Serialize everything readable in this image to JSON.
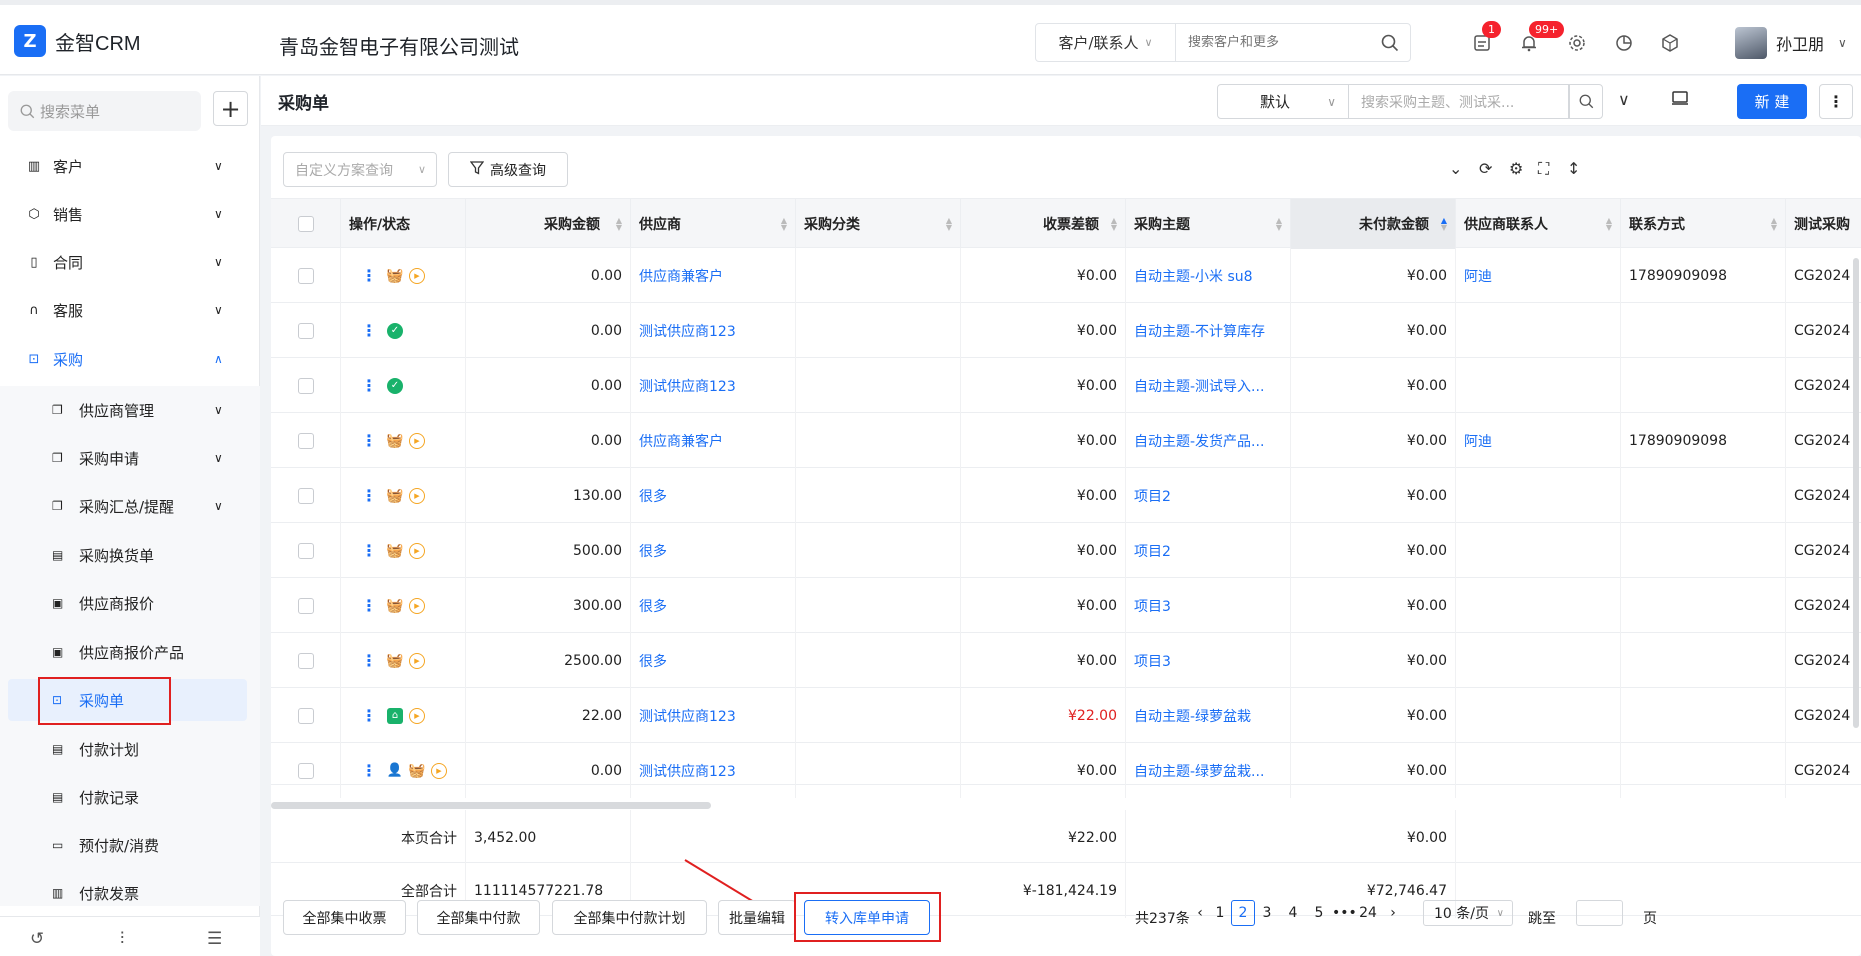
{
  "app": {
    "logo_text": "金智CRM",
    "company": "青岛金智电子有限公司测试"
  },
  "global_search": {
    "scope": "客户/联系人",
    "placeholder": "搜索客户和更多"
  },
  "notifications": {
    "tasks_count": "1",
    "bell_count": "99+"
  },
  "user": {
    "name": "孙卫朋"
  },
  "sidebar": {
    "search_placeholder": "搜索菜单",
    "items": [
      {
        "label": "客户"
      },
      {
        "label": "销售"
      },
      {
        "label": "合同"
      },
      {
        "label": "客服"
      },
      {
        "label": "采购"
      }
    ],
    "sub_items": [
      {
        "label": "供应商管理"
      },
      {
        "label": "采购申请"
      },
      {
        "label": "采购汇总/提醒"
      },
      {
        "label": "采购换货单"
      },
      {
        "label": "供应商报价"
      },
      {
        "label": "供应商报价产品"
      },
      {
        "label": "采购单"
      },
      {
        "label": "付款计划"
      },
      {
        "label": "付款记录"
      },
      {
        "label": "预付款/消费"
      },
      {
        "label": "付款发票"
      }
    ]
  },
  "page": {
    "title": "采购单",
    "view_select": "默认",
    "search_placeholder": "搜索采购主题、测试采...",
    "new_label": "新 建",
    "custom_query_placeholder": "自定义方案查询",
    "advanced_query_label": "高级查询"
  },
  "table": {
    "columns": [
      "操作/状态",
      "采购金额",
      "供应商",
      "采购分类",
      "收票差额",
      "采购主题",
      "未付款金额",
      "供应商联系人",
      "联系方式",
      "测试采购"
    ],
    "rows": [
      {
        "amount": "0.00",
        "supplier": "供应商兼客户",
        "category": "",
        "invoice_diff": "¥0.00",
        "subject": "自动主题-小米 su8",
        "unpaid": "¥0.00",
        "contact": "阿迪",
        "phone": "17890909098",
        "code": "CG2024"
      },
      {
        "amount": "0.00",
        "supplier": "测试供应商123",
        "category": "",
        "invoice_diff": "¥0.00",
        "subject": "自动主题-不计算库存",
        "unpaid": "¥0.00",
        "contact": "",
        "phone": "",
        "code": "CG2024"
      },
      {
        "amount": "0.00",
        "supplier": "测试供应商123",
        "category": "",
        "invoice_diff": "¥0.00",
        "subject": "自动主题-测试导入...",
        "unpaid": "¥0.00",
        "contact": "",
        "phone": "",
        "code": "CG2024"
      },
      {
        "amount": "0.00",
        "supplier": "供应商兼客户",
        "category": "",
        "invoice_diff": "¥0.00",
        "subject": "自动主题-发货产品...",
        "unpaid": "¥0.00",
        "contact": "阿迪",
        "phone": "17890909098",
        "code": "CG2024"
      },
      {
        "amount": "130.00",
        "supplier": "很多",
        "category": "",
        "invoice_diff": "¥0.00",
        "subject": "项目2",
        "unpaid": "¥0.00",
        "contact": "",
        "phone": "",
        "code": "CG2024"
      },
      {
        "amount": "500.00",
        "supplier": "很多",
        "category": "",
        "invoice_diff": "¥0.00",
        "subject": "项目2",
        "unpaid": "¥0.00",
        "contact": "",
        "phone": "",
        "code": "CG2024"
      },
      {
        "amount": "300.00",
        "supplier": "很多",
        "category": "",
        "invoice_diff": "¥0.00",
        "subject": "项目3",
        "unpaid": "¥0.00",
        "contact": "",
        "phone": "",
        "code": "CG2024"
      },
      {
        "amount": "2500.00",
        "supplier": "很多",
        "category": "",
        "invoice_diff": "¥0.00",
        "subject": "项目3",
        "unpaid": "¥0.00",
        "contact": "",
        "phone": "",
        "code": "CG2024"
      },
      {
        "amount": "22.00",
        "supplier": "测试供应商123",
        "category": "",
        "invoice_diff": "¥22.00",
        "subject": "自动主题-绿萝盆栽",
        "unpaid": "¥0.00",
        "contact": "",
        "phone": "",
        "code": "CG2024"
      },
      {
        "amount": "0.00",
        "supplier": "测试供应商123",
        "category": "",
        "invoice_diff": "¥0.00",
        "subject": "自动主题-绿萝盆栽...",
        "unpaid": "¥0.00",
        "contact": "",
        "phone": "",
        "code": "CG2024"
      }
    ],
    "page_total": {
      "label": "本页合计",
      "amount": "3,452.00",
      "invoice_diff": "¥22.00",
      "unpaid": "¥0.00"
    },
    "grand_total": {
      "label": "全部合计",
      "amount": "111114577221.78",
      "invoice_diff": "¥-181,424.19",
      "unpaid": "¥72,746.47"
    }
  },
  "bottom_actions": [
    "全部集中收票",
    "全部集中付款",
    "全部集中付款计划",
    "批量编辑",
    "转入库单申请"
  ],
  "pagination": {
    "total": "共237条",
    "pages": [
      "1",
      "2",
      "3",
      "4",
      "5",
      "•••",
      "24"
    ],
    "current": "2",
    "page_size": "10 条/页",
    "jump_label": "跳至",
    "page_unit": "页"
  },
  "colors": {
    "accent": "#1a6ef5",
    "danger": "#e02020",
    "success": "#19b26b",
    "warning": "#f5a623"
  }
}
